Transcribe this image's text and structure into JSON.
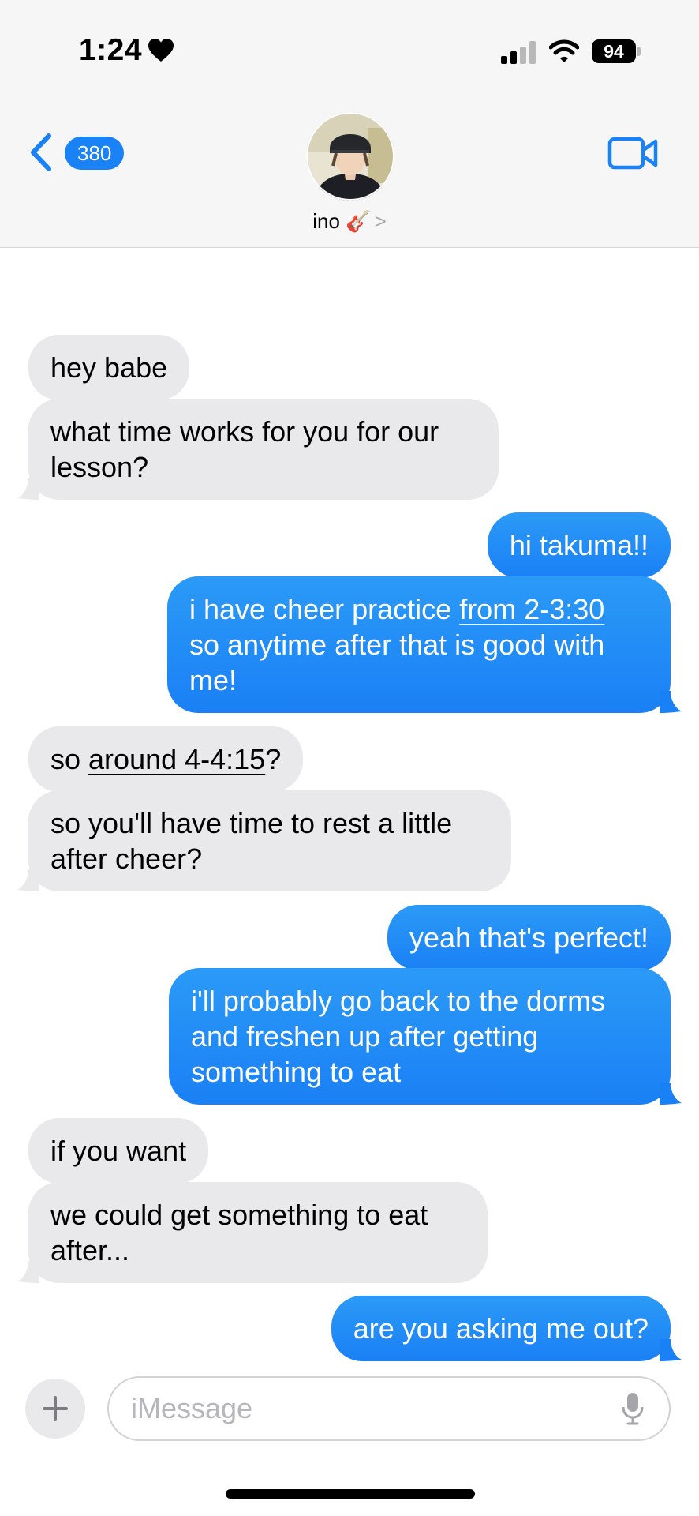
{
  "status_bar": {
    "time": "1:24",
    "battery": "94"
  },
  "header": {
    "back_count": "380",
    "contact_name": "ino 🎸",
    "chevron": ">"
  },
  "messages": [
    {
      "side": "in",
      "text": "hey babe"
    },
    {
      "side": "in",
      "text_lines": [
        "what time works for you for our",
        "lesson?"
      ]
    },
    {
      "side": "out",
      "text": "hi takuma!!"
    },
    {
      "side": "out",
      "parts": [
        "i have cheer practice ",
        "from 2-3:30",
        "so anytime after that is good with",
        "me!"
      ]
    },
    {
      "side": "in",
      "parts": [
        "so ",
        "around 4-4:15",
        "?"
      ]
    },
    {
      "side": "in",
      "text_lines": [
        "so you'll have time to rest a little",
        "after cheer?"
      ]
    },
    {
      "side": "out",
      "text": "yeah that's perfect!"
    },
    {
      "side": "out",
      "text_lines": [
        "i'll probably go back to the dorms",
        "and freshen up after getting",
        "something to eat"
      ]
    },
    {
      "side": "in",
      "text": "if you want"
    },
    {
      "side": "in",
      "text_lines": [
        "we could get something to eat",
        "after..."
      ]
    },
    {
      "side": "out",
      "text": "are you asking me out?"
    }
  ],
  "composer": {
    "placeholder": "iMessage"
  },
  "colors": {
    "outgoing": "#1a82f7",
    "incoming": "#e9e9eb"
  }
}
